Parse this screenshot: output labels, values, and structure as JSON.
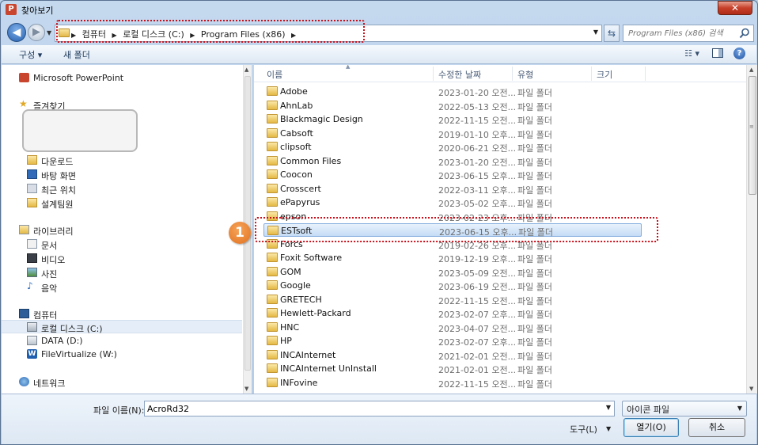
{
  "window": {
    "title": "찾아보기",
    "app_icon_letter": "P",
    "close_glyph": "✕"
  },
  "address_bar": {
    "crumbs": [
      "컴퓨터",
      "로컬 디스크 (C:)",
      "Program Files (x86)"
    ],
    "search_placeholder": "Program Files (x86) 검색"
  },
  "toolbar": {
    "organize_label": "구성 ▾",
    "new_folder_label": "새 폴더"
  },
  "nav_pane": {
    "items": [
      {
        "label": "Microsoft PowerPoint",
        "icon": "powerpoint-icon"
      },
      {
        "label": "즐겨찾기",
        "icon": "star-icon"
      },
      {
        "label": "다운로드",
        "icon": "downloads-folder-icon"
      },
      {
        "label": "바탕 화면",
        "icon": "desktop-icon"
      },
      {
        "label": "최근 위치",
        "icon": "recent-places-icon"
      },
      {
        "label": "설계팀원",
        "icon": "folder-icon"
      },
      {
        "label": "라이브러리",
        "icon": "library-icon"
      },
      {
        "label": "문서",
        "icon": "documents-icon"
      },
      {
        "label": "비디오",
        "icon": "videos-icon"
      },
      {
        "label": "사진",
        "icon": "pictures-icon"
      },
      {
        "label": "음악",
        "icon": "music-icon"
      },
      {
        "label": "컴퓨터",
        "icon": "computer-icon"
      },
      {
        "label": "로컬 디스크 (C:)",
        "icon": "local-disk-icon"
      },
      {
        "label": "DATA (D:)",
        "icon": "drive-icon"
      },
      {
        "label": "FileVirtualize (W:)",
        "icon": "filevirtualize-icon"
      },
      {
        "label": "네트워크",
        "icon": "network-icon"
      }
    ]
  },
  "columns": {
    "name": "이름",
    "modified": "수정한 날짜",
    "type": "유형",
    "size": "크기"
  },
  "files": [
    {
      "name": "Adobe",
      "date": "2023-01-20 오전...",
      "type": "파일 폴더"
    },
    {
      "name": "AhnLab",
      "date": "2022-05-13 오전...",
      "type": "파일 폴더"
    },
    {
      "name": "Blackmagic Design",
      "date": "2022-11-15 오전...",
      "type": "파일 폴더"
    },
    {
      "name": "Cabsoft",
      "date": "2019-01-10 오후...",
      "type": "파일 폴더"
    },
    {
      "name": "clipsoft",
      "date": "2020-06-21 오전...",
      "type": "파일 폴더"
    },
    {
      "name": "Common Files",
      "date": "2023-01-20 오전...",
      "type": "파일 폴더"
    },
    {
      "name": "Coocon",
      "date": "2023-06-15 오후...",
      "type": "파일 폴더"
    },
    {
      "name": "Crosscert",
      "date": "2022-03-11 오후...",
      "type": "파일 폴더"
    },
    {
      "name": "ePapyrus",
      "date": "2023-05-02 오후...",
      "type": "파일 폴더"
    },
    {
      "name": "epson",
      "date": "2023-02-23 오후...",
      "type": "파일 폴더"
    },
    {
      "name": "ESTsoft",
      "date": "2023-06-15 오후...",
      "type": "파일 폴더"
    },
    {
      "name": "Forcs",
      "date": "2019-02-26 오후...",
      "type": "파일 폴더"
    },
    {
      "name": "Foxit Software",
      "date": "2019-12-19 오후...",
      "type": "파일 폴더"
    },
    {
      "name": "GOM",
      "date": "2023-05-09 오전...",
      "type": "파일 폴더"
    },
    {
      "name": "Google",
      "date": "2023-06-19 오전...",
      "type": "파일 폴더"
    },
    {
      "name": "GRETECH",
      "date": "2022-11-15 오전...",
      "type": "파일 폴더"
    },
    {
      "name": "Hewlett-Packard",
      "date": "2023-02-07 오후...",
      "type": "파일 폴더"
    },
    {
      "name": "HNC",
      "date": "2023-04-07 오전...",
      "type": "파일 폴더"
    },
    {
      "name": "HP",
      "date": "2023-02-07 오후...",
      "type": "파일 폴더"
    },
    {
      "name": "INCAInternet",
      "date": "2021-02-01 오전...",
      "type": "파일 폴더"
    },
    {
      "name": "INCAInternet UnInstall",
      "date": "2021-02-01 오전...",
      "type": "파일 폴더"
    },
    {
      "name": "INFovine",
      "date": "2022-11-15 오전...",
      "type": "파일 폴더"
    }
  ],
  "selected_file": "ESTsoft",
  "annotation": {
    "step_number": "1",
    "color": "#c8101a",
    "badge_color": "#e1711f"
  },
  "bottom": {
    "filename_label": "파일 이름(N):",
    "filename_value": "AcroRd32",
    "filetype_value": "아이콘 파일",
    "tools_label": "도구(L)",
    "open_label": "열기(O)",
    "cancel_label": "취소"
  }
}
